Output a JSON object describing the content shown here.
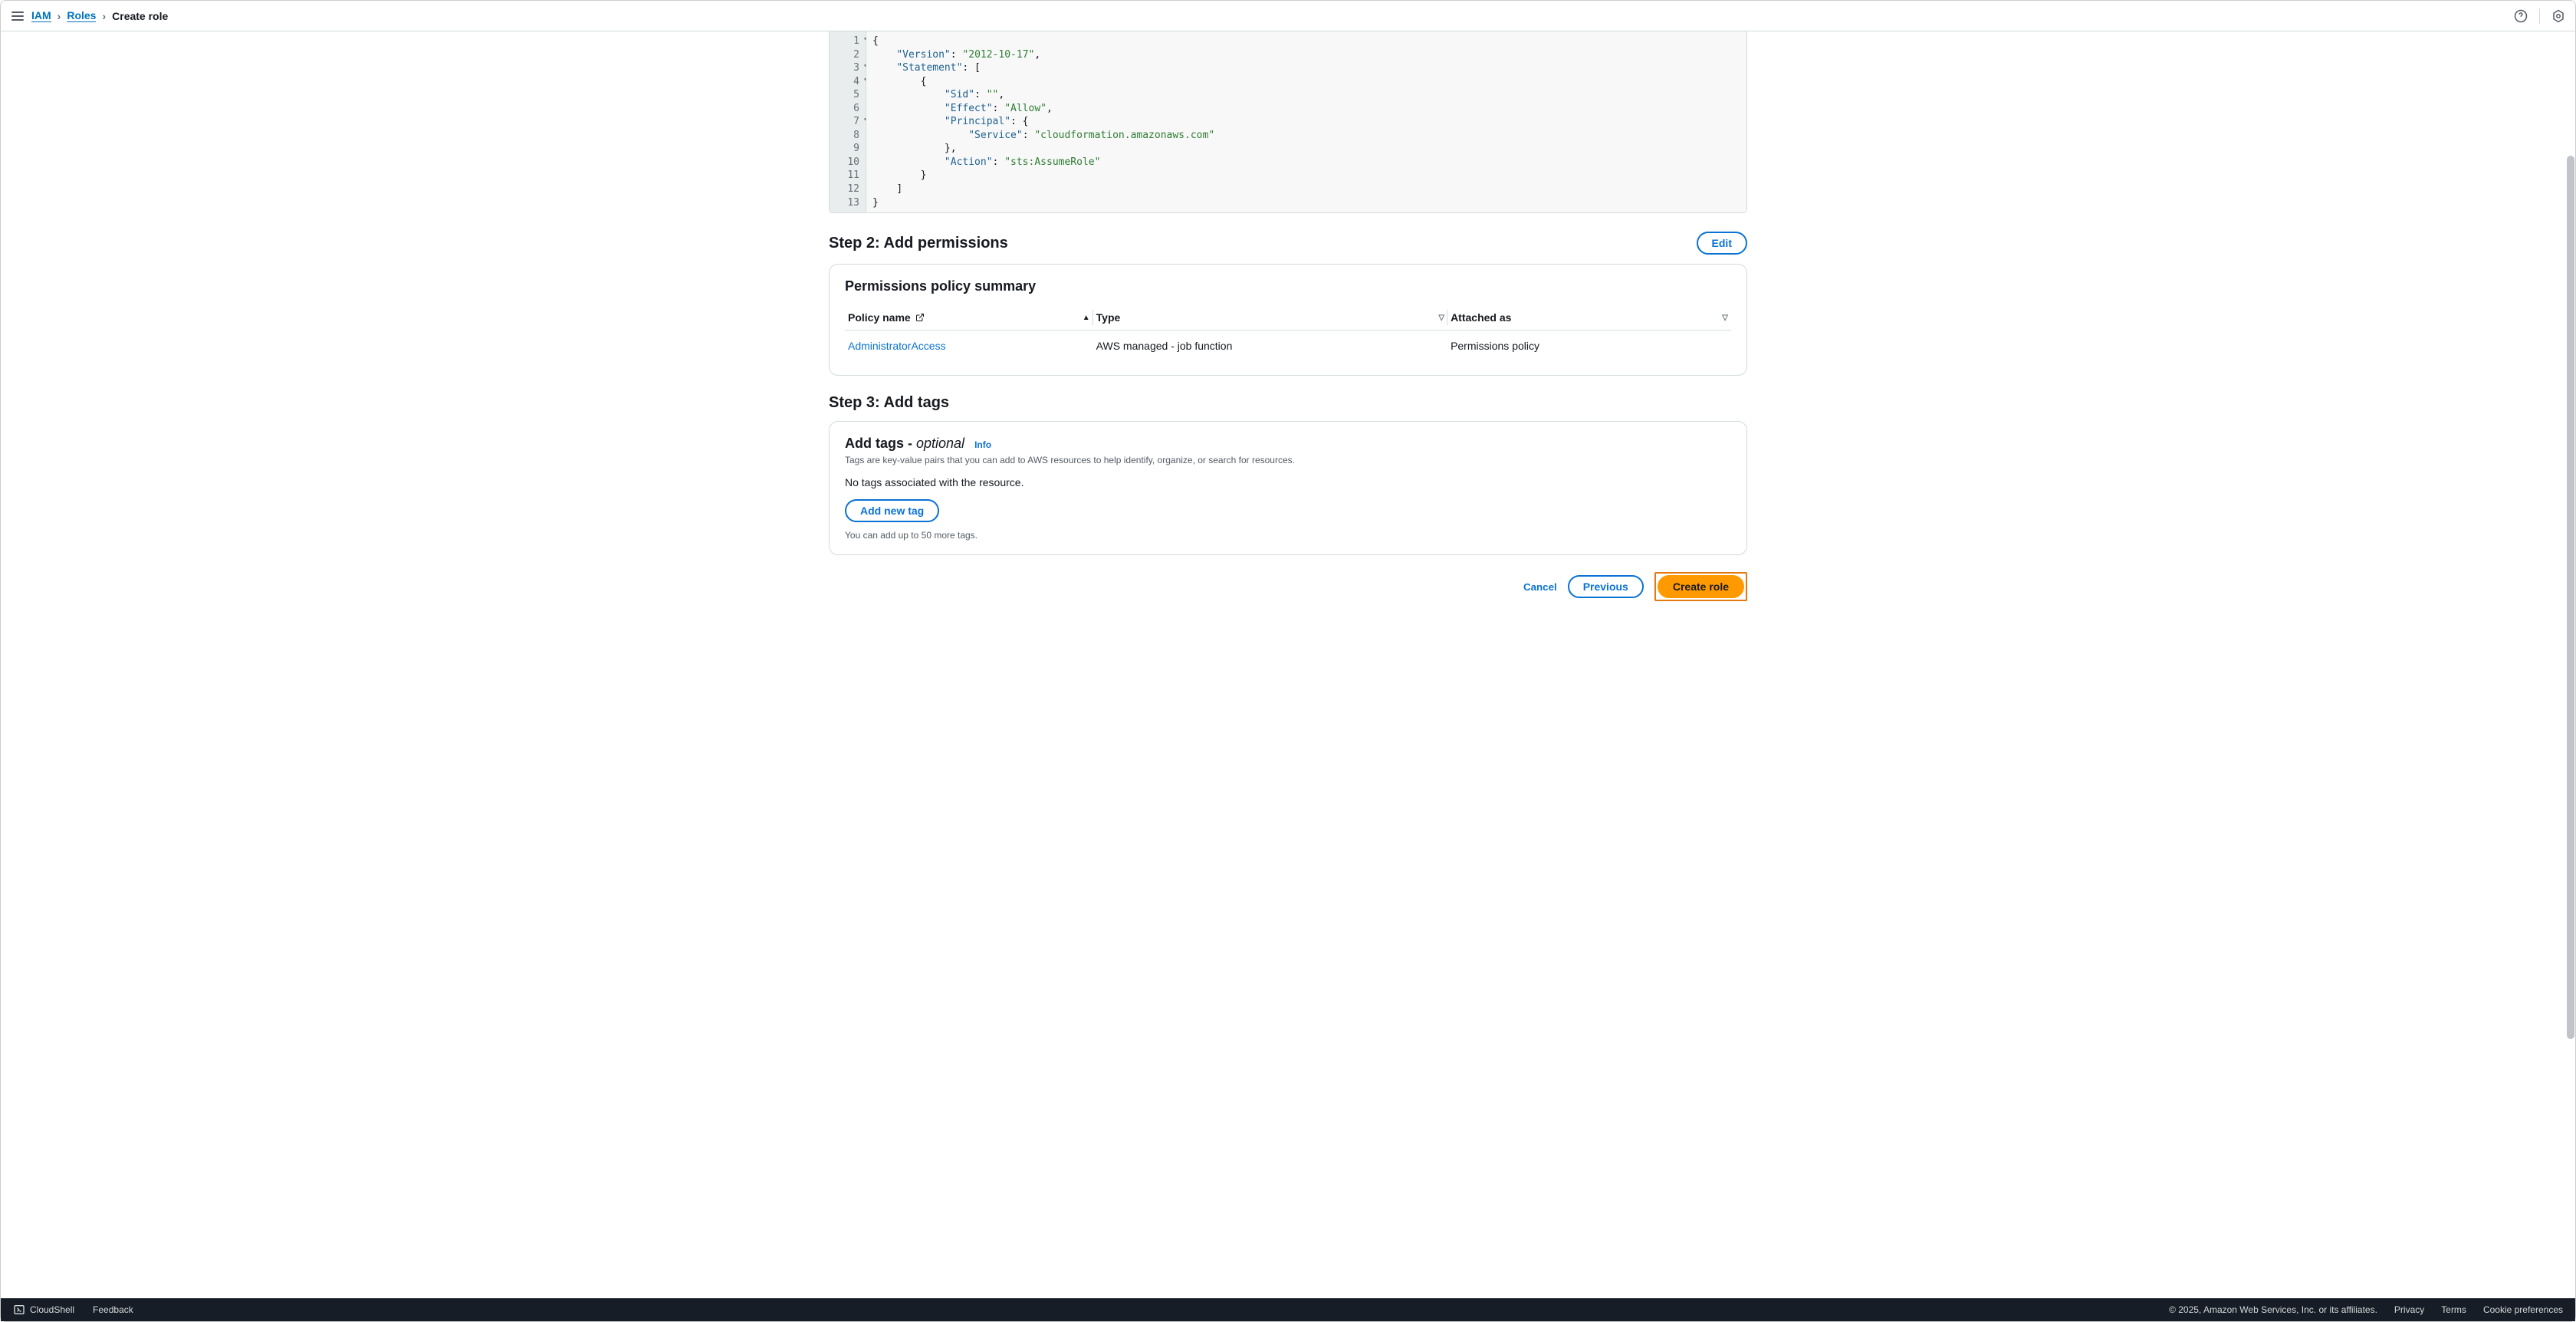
{
  "breadcrumb": {
    "iam": "IAM",
    "roles": "Roles",
    "current": "Create role"
  },
  "editor": {
    "lines": [
      {
        "n": 1,
        "fold": true,
        "segs": [
          {
            "t": "{",
            "c": "punc"
          }
        ],
        "cursor": true
      },
      {
        "n": 2,
        "indent": 1,
        "segs": [
          {
            "t": "\"Version\"",
            "c": "key"
          },
          {
            "t": ": ",
            "c": "punc"
          },
          {
            "t": "\"2012-10-17\"",
            "c": "str"
          },
          {
            "t": ",",
            "c": "punc"
          }
        ]
      },
      {
        "n": 3,
        "fold": true,
        "indent": 1,
        "segs": [
          {
            "t": "\"Statement\"",
            "c": "key"
          },
          {
            "t": ": [",
            "c": "punc"
          }
        ]
      },
      {
        "n": 4,
        "fold": true,
        "indent": 2,
        "segs": [
          {
            "t": "{",
            "c": "punc"
          }
        ]
      },
      {
        "n": 5,
        "indent": 3,
        "segs": [
          {
            "t": "\"Sid\"",
            "c": "key"
          },
          {
            "t": ": ",
            "c": "punc"
          },
          {
            "t": "\"\"",
            "c": "str"
          },
          {
            "t": ",",
            "c": "punc"
          }
        ]
      },
      {
        "n": 6,
        "indent": 3,
        "segs": [
          {
            "t": "\"Effect\"",
            "c": "key"
          },
          {
            "t": ": ",
            "c": "punc"
          },
          {
            "t": "\"Allow\"",
            "c": "str"
          },
          {
            "t": ",",
            "c": "punc"
          }
        ]
      },
      {
        "n": 7,
        "fold": true,
        "indent": 3,
        "segs": [
          {
            "t": "\"Principal\"",
            "c": "key"
          },
          {
            "t": ": {",
            "c": "punc"
          }
        ]
      },
      {
        "n": 8,
        "indent": 4,
        "segs": [
          {
            "t": "\"Service\"",
            "c": "key"
          },
          {
            "t": ": ",
            "c": "punc"
          },
          {
            "t": "\"cloudformation.amazonaws.com\"",
            "c": "str"
          }
        ]
      },
      {
        "n": 9,
        "indent": 3,
        "segs": [
          {
            "t": "},",
            "c": "punc"
          }
        ]
      },
      {
        "n": 10,
        "indent": 3,
        "segs": [
          {
            "t": "\"Action\"",
            "c": "key"
          },
          {
            "t": ": ",
            "c": "punc"
          },
          {
            "t": "\"sts:AssumeRole\"",
            "c": "str"
          }
        ]
      },
      {
        "n": 11,
        "indent": 2,
        "segs": [
          {
            "t": "}",
            "c": "punc"
          }
        ]
      },
      {
        "n": 12,
        "indent": 1,
        "segs": [
          {
            "t": "]",
            "c": "punc"
          }
        ]
      },
      {
        "n": 13,
        "segs": [
          {
            "t": "}",
            "c": "punc"
          }
        ]
      }
    ]
  },
  "step2": {
    "title": "Step 2: Add permissions",
    "edit": "Edit"
  },
  "perms": {
    "summary_title": "Permissions policy summary",
    "cols": {
      "name": "Policy name",
      "type": "Type",
      "attached": "Attached as"
    },
    "rows": [
      {
        "name": "AdministratorAccess",
        "type": "AWS managed - job function",
        "attached": "Permissions policy"
      }
    ]
  },
  "step3": {
    "title": "Step 3: Add tags"
  },
  "tags": {
    "head": "Add tags - ",
    "optional": "optional",
    "info": "Info",
    "desc": "Tags are key-value pairs that you can add to AWS resources to help identify, organize, or search for resources.",
    "none": "No tags associated with the resource.",
    "add_btn": "Add new tag",
    "hint": "You can add up to 50 more tags."
  },
  "actions": {
    "cancel": "Cancel",
    "previous": "Previous",
    "create": "Create role"
  },
  "footer": {
    "cloudshell": "CloudShell",
    "feedback": "Feedback",
    "copyright": "© 2025, Amazon Web Services, Inc. or its affiliates.",
    "privacy": "Privacy",
    "terms": "Terms",
    "cookies": "Cookie preferences"
  }
}
